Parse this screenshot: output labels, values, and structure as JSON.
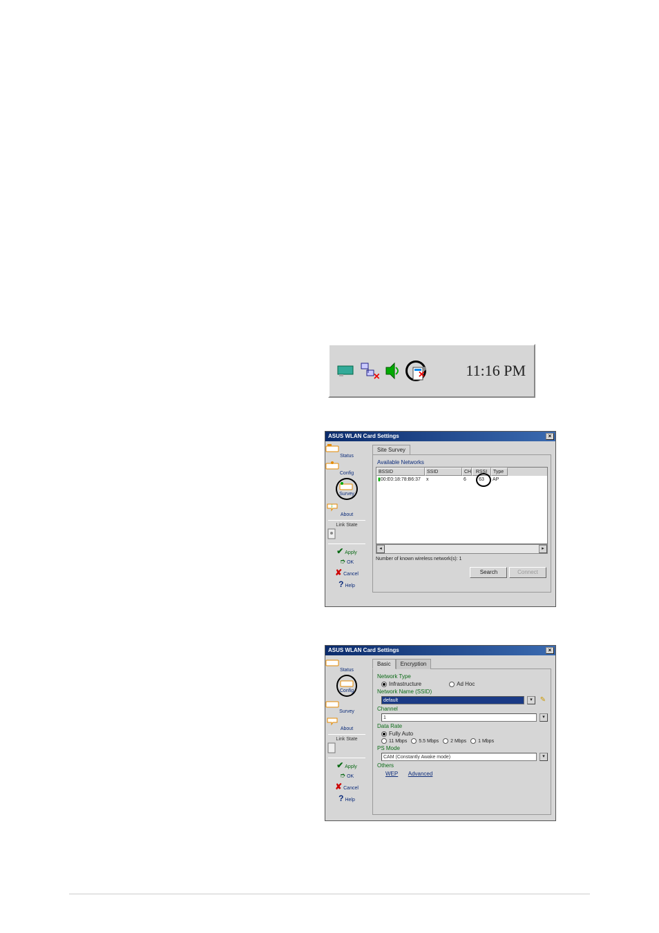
{
  "tray": {
    "clock": "11:16 PM",
    "icons": [
      "pci-card-icon",
      "network-icon",
      "volume-icon",
      "wlan-util-icon"
    ],
    "circled_index": 3
  },
  "dialog1": {
    "title": "ASUS WLAN Card Settings",
    "sidenav": {
      "status": "Status",
      "config": "Config",
      "survey": "Survey",
      "about": "About",
      "linkstate": "Link State",
      "apply": "Apply",
      "ok": "OK",
      "cancel": "Cancel",
      "help": "Help"
    },
    "tabs": {
      "sitesurvey": "Site Survey"
    },
    "grouplabel": "Available Networks",
    "columns": {
      "bssid": "BSSID",
      "ssid": "SSID",
      "ch": "CH",
      "rssi": "RSSI",
      "type": "Type"
    },
    "row1": {
      "bssid": "00:E0:18:78:B6:37",
      "ssid": "x",
      "ch": "6",
      "rssi": "63",
      "type": "AP"
    },
    "countline": "Number of known wireless network(s): 1",
    "buttons": {
      "search": "Search",
      "connect": "Connect"
    }
  },
  "dialog2": {
    "title": "ASUS WLAN Card Settings",
    "sidenav": {
      "status": "Status",
      "config": "Config",
      "survey": "Survey",
      "about": "About",
      "linkstate": "Link State",
      "apply": "Apply",
      "ok": "OK",
      "cancel": "Cancel",
      "help": "Help"
    },
    "tabs": {
      "basic": "Basic",
      "encryption": "Encryption"
    },
    "groups": {
      "nettype": "Network Type",
      "infra": "Infrastructure",
      "adhoc": "Ad Hoc",
      "ssid": "Network Name (SSID)",
      "ssidval": "default",
      "channel": "Channel",
      "chval": "1",
      "datarate": "Data Rate",
      "fullyauto": "Fully Auto",
      "r11": "11 Mbps",
      "r55": "5.5 Mbps",
      "r2": "2 Mbps",
      "r1": "1 Mbps",
      "psmode": "PS Mode",
      "psval": "CAM (Constantly Awake mode)",
      "others": "Others",
      "wep": "WEP",
      "advanced": "Advanced"
    }
  }
}
